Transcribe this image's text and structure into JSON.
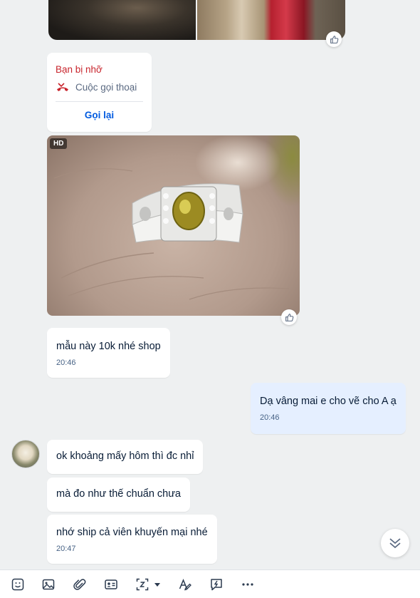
{
  "call_card": {
    "title": "Bạn bị nhỡ",
    "call_type": "Cuộc gọi thoại",
    "call_back": "Gọi lại"
  },
  "image_message": {
    "badge": "HD"
  },
  "messages": [
    {
      "side": "incoming",
      "text": "mẫu này 10k nhé shop",
      "time": "20:46"
    },
    {
      "side": "outgoing",
      "text": "Dạ vâng mai e cho vẽ cho A ạ",
      "time": "20:46"
    },
    {
      "side": "incoming",
      "text": "ok khoảng mấy hôm thì đc nhỉ",
      "time": ""
    },
    {
      "side": "incoming",
      "text": "mà đo như thế chuẩn chưa",
      "time": ""
    },
    {
      "side": "incoming",
      "text": "nhớ ship cả viên khuyến mại nhé",
      "time": "20:47"
    }
  ],
  "icons": {
    "like": "thumbs-up-icon",
    "missed_call": "missed-call-icon",
    "scroll_down": "double-chevron-down-icon",
    "toolbar": [
      "sticker-icon",
      "image-icon",
      "attachment-icon",
      "contact-card-icon",
      "screenshot-icon",
      "dropdown-caret-icon",
      "text-format-icon",
      "quick-message-icon",
      "more-icon"
    ]
  },
  "colors": {
    "background": "#eef0f1",
    "incoming_bubble": "#ffffff",
    "outgoing_bubble": "#e5efff",
    "missed_call_red": "#c8252d",
    "link_blue": "#005ae0",
    "time_text": "#476285"
  }
}
